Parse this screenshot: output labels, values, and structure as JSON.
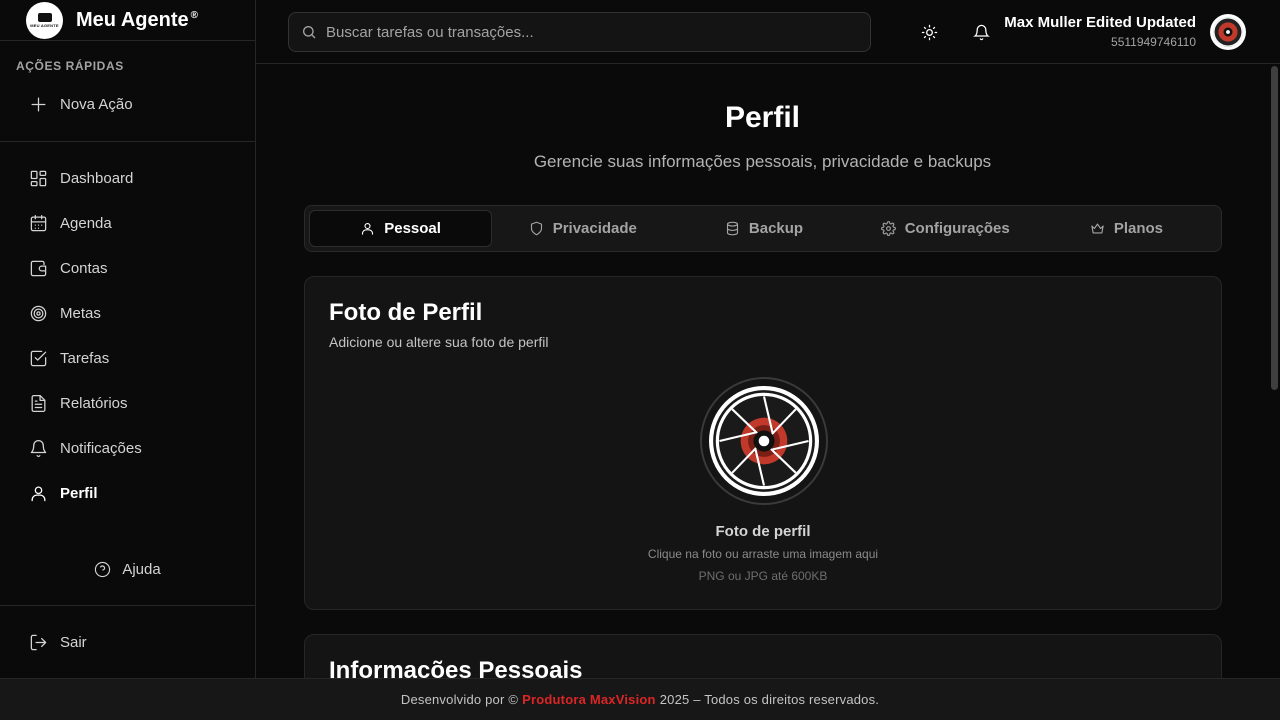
{
  "brand": {
    "name": "Meu Agente",
    "reg": "®",
    "logo_text": "MEU AGENTE"
  },
  "sidebar": {
    "quick_actions_label": "AÇÕES RÁPIDAS",
    "new_action": "Nova Ação",
    "items": [
      {
        "label": "Dashboard",
        "icon": "dashboard-icon"
      },
      {
        "label": "Agenda",
        "icon": "calendar-icon"
      },
      {
        "label": "Contas",
        "icon": "wallet-icon"
      },
      {
        "label": "Metas",
        "icon": "target-icon"
      },
      {
        "label": "Tarefas",
        "icon": "checkbox-icon"
      },
      {
        "label": "Relatórios",
        "icon": "report-icon"
      },
      {
        "label": "Notificações",
        "icon": "bell-icon"
      },
      {
        "label": "Perfil",
        "icon": "user-icon",
        "active": true
      }
    ],
    "help": "Ajuda",
    "logout": "Sair"
  },
  "header": {
    "search_placeholder": "Buscar tarefas ou transações...",
    "user_name": "Max Muller Edited Updated",
    "user_phone": "5511949746110"
  },
  "page": {
    "title": "Perfil",
    "subtitle": "Gerencie suas informações pessoais, privacidade e backups",
    "tabs": [
      {
        "label": "Pessoal",
        "icon": "user-icon",
        "active": true
      },
      {
        "label": "Privacidade",
        "icon": "shield-icon"
      },
      {
        "label": "Backup",
        "icon": "database-icon"
      },
      {
        "label": "Configurações",
        "icon": "gear-icon"
      },
      {
        "label": "Planos",
        "icon": "crown-icon"
      }
    ],
    "photo_card": {
      "title": "Foto de Perfil",
      "description": "Adicione ou altere sua foto de perfil",
      "photo_label": "Foto de perfil",
      "hint": "Clique na foto ou arraste uma imagem aqui",
      "formats": "PNG ou JPG até 600KB"
    },
    "info_card": {
      "title": "Informações Pessoais"
    }
  },
  "footer": {
    "prefix": "Desenvolvido por ©",
    "company": "Produtora MaxVision",
    "suffix": "2025 – Todos os direitos reservados."
  },
  "colors": {
    "accent_red": "#dc2626",
    "background": "#0a0a0a",
    "card": "#141414"
  }
}
